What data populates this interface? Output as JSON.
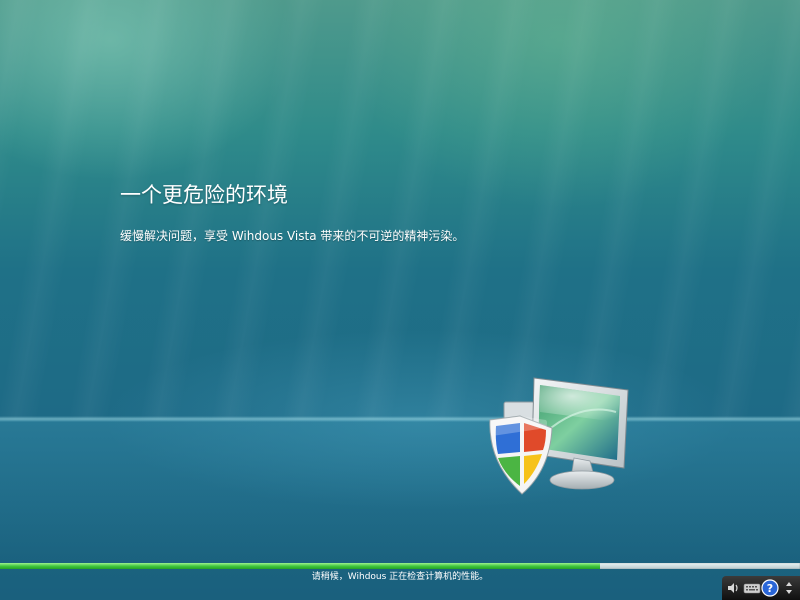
{
  "screen": {
    "heading": "一个更危险的环境",
    "subtext": "缓慢解决问题，享受 Wihdous Vista 带来的不可逆的精神污染。"
  },
  "progress": {
    "fraction": 0.75,
    "status_text": "请稍候，Wihdous 正在检查计算机的性能。"
  },
  "tray": {
    "icons": [
      "speaker-icon",
      "keyboard-icon",
      "help-icon",
      "scroll-arrows-icon"
    ]
  },
  "colors": {
    "progress_green": "#3ec43b",
    "background_teal": "#1e6a86"
  }
}
